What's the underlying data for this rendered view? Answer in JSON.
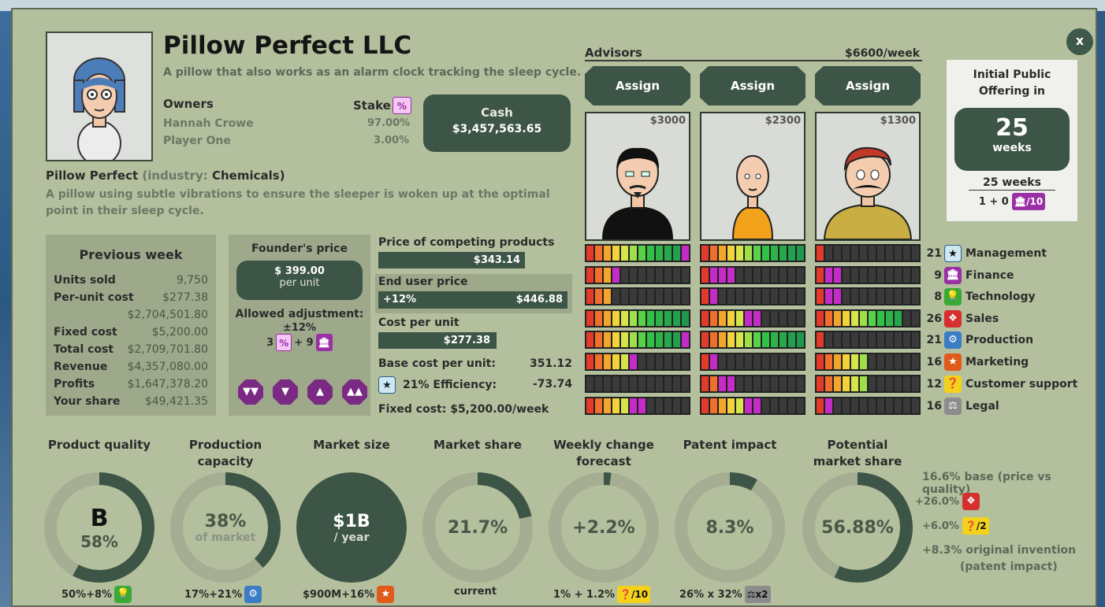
{
  "company": {
    "name": "Pillow Perfect LLC",
    "tagline": "A pillow that also works as an alarm clock tracking the sleep cycle.",
    "owners_label": "Owners",
    "stake_label": "Stake",
    "owners": [
      {
        "name": "Hannah Crowe",
        "stake": "97.00%"
      },
      {
        "name": "Player One",
        "stake": "3.00%"
      }
    ],
    "cash_label": "Cash",
    "cash_value": "$3,457,563.65",
    "product_name": "Pillow Perfect",
    "industry_prefix": "(industry:",
    "industry": "Chemicals)",
    "description": "A pillow using subtle vibrations to ensure the sleeper is woken up at the optimal point in their sleep cycle."
  },
  "previous_week": {
    "title": "Previous week",
    "rows": [
      {
        "label": "Units sold",
        "value": "9,750"
      },
      {
        "label": "Per-unit cost",
        "value": "$277.38"
      },
      {
        "label": "",
        "value": "$2,704,501.80"
      },
      {
        "label": "Fixed cost",
        "value": "$5,200.00"
      },
      {
        "label": "Total cost",
        "value": "$2,709,701.80"
      },
      {
        "label": "Revenue",
        "value": "$4,357,080.00"
      },
      {
        "label": "Profits",
        "value": "$1,647,378.20"
      },
      {
        "label": "Your share",
        "value": "$49,421.35"
      }
    ]
  },
  "founder": {
    "title": "Founder's price",
    "price": "$ 399.00",
    "unit": "per unit",
    "allowed_label": "Allowed adjustment:",
    "allowed_value": "±12%",
    "formula_a": "3",
    "formula_b": "+ 9"
  },
  "pricing": {
    "competing_label": "Price of competing products",
    "competing_value": "$343.14",
    "end_user_label": "End user price",
    "end_user_delta": "+12%",
    "end_user_value": "$446.88",
    "cost_label": "Cost per unit",
    "cost_value": "$277.38",
    "base_label": "Base cost per unit:",
    "base_value": "351.12",
    "efficiency_label": "21% Efficiency:",
    "efficiency_value": "-73.74",
    "fixed_cost": "Fixed cost: $5,200.00/week"
  },
  "advisors": {
    "title": "Advisors",
    "weekly": "$6600/week",
    "assign_label": "Assign",
    "list": [
      {
        "price": "$3000"
      },
      {
        "price": "$2300"
      },
      {
        "price": "$1300"
      }
    ]
  },
  "skills": [
    {
      "num": "21",
      "label": "Management",
      "icon": "star-icon",
      "color": "#2a5f8f"
    },
    {
      "num": "9",
      "label": "Finance",
      "icon": "bank-icon",
      "color": "#9b2fa5"
    },
    {
      "num": "8",
      "label": "Technology",
      "icon": "bulb-icon",
      "color": "#3aaa35"
    },
    {
      "num": "26",
      "label": "Sales",
      "icon": "sales-icon",
      "color": "#d62f2f"
    },
    {
      "num": "21",
      "label": "Production",
      "icon": "gear-icon",
      "color": "#3b7dc4"
    },
    {
      "num": "16",
      "label": "Marketing",
      "icon": "marketing-star-icon",
      "color": "#e05a1a"
    },
    {
      "num": "12",
      "label": "Customer support",
      "icon": "chat-icon",
      "color": "#f4d21c"
    },
    {
      "num": "16",
      "label": "Legal",
      "icon": "gavel-icon",
      "color": "#777777"
    }
  ],
  "ipo": {
    "title": "Initial Public Offering in",
    "value": "25",
    "unit": "weeks",
    "sub": "25 weeks",
    "formula": "1 + 0",
    "chip": "/10"
  },
  "stats": [
    {
      "label": "Product quality",
      "main": "B",
      "sub": "58%",
      "foot": "50%+8%",
      "fill": 0.58
    },
    {
      "label": "Production capacity",
      "main": "38%",
      "sub": "of market",
      "foot": "17%+21%",
      "fill": 0.38
    },
    {
      "label": "Market size",
      "main": "$1B",
      "sub": "/ year",
      "foot": "$900M+16%",
      "fill": 1.0
    },
    {
      "label": "Market share",
      "main": "21.7%",
      "sub": "",
      "foot": "current",
      "fill": 0.217
    },
    {
      "label": "Weekly change forecast",
      "main": "+2.2%",
      "sub": "",
      "foot": "1% + 1.2%",
      "fill": 0.022
    },
    {
      "label": "Patent impact",
      "main": "8.3%",
      "sub": "",
      "foot": "26% x 32%",
      "fill": 0.083
    },
    {
      "label": "Potential market share",
      "main": "56.88%",
      "sub": "",
      "foot": "",
      "fill": 0.5688
    }
  ],
  "footchips": {
    "support": "/10",
    "legal": "x2"
  },
  "potential_breakdown": {
    "base": "16.6% base (price vs quality)",
    "sales": "+26.0%",
    "support": "+6.0%",
    "support_chip": "/2",
    "invention": "+8.3% original invention",
    "invention_sub": "(patent impact)"
  }
}
